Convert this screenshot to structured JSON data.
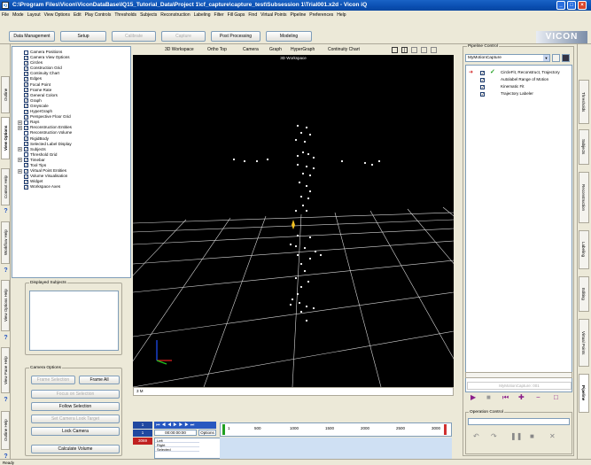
{
  "window": {
    "title": "C:\\Program Files\\Vicon\\ViconDataBase\\IQ15_Tutorial_Data\\Project 1\\cf_capture\\capture_test\\Subsession 1\\Trial001.x2d - Vicon iQ",
    "minimize": "_",
    "maximize": "□",
    "close": "×",
    "brand": "VICON"
  },
  "menu": [
    "File",
    "Mode",
    "Layout",
    "View Options",
    "Edit",
    "Play Controls",
    "Thresholds",
    "Subjects",
    "Reconstruction",
    "Labeling",
    "Filter",
    "Fill Gaps",
    "Find",
    "Virtual Points",
    "Pipeline",
    "Preferences",
    "Help"
  ],
  "toolbar": {
    "data_management": "Data Management",
    "setup": "Setup",
    "calibrate": "Calibrate",
    "capture": "Capture",
    "post_processing": "Post Processing",
    "modeling": "Modeling"
  },
  "left_tabs": [
    "Outline",
    "View Options",
    "Context Help",
    "Workflow Help",
    "View Options Help",
    "View Pane Help",
    "Outline Help"
  ],
  "view_options": {
    "items": [
      {
        "label": "Camera Positions",
        "checked": false,
        "expander": false
      },
      {
        "label": "Camera View Options",
        "checked": true,
        "expander": false
      },
      {
        "label": "Circles",
        "checked": true,
        "expander": false
      },
      {
        "label": "Construction Grid",
        "checked": true,
        "expander": false
      },
      {
        "label": "Continuity Chart",
        "checked": true,
        "expander": false
      },
      {
        "label": "Edges",
        "checked": true,
        "expander": false
      },
      {
        "label": "Focal Point",
        "checked": true,
        "expander": false
      },
      {
        "label": "Frame Rate",
        "checked": true,
        "expander": false
      },
      {
        "label": "General Colors",
        "checked": true,
        "expander": false
      },
      {
        "label": "Graph",
        "checked": true,
        "expander": false
      },
      {
        "label": "Greyscale",
        "checked": true,
        "expander": false
      },
      {
        "label": "HyperGraph",
        "checked": true,
        "expander": false
      },
      {
        "label": "Perspective Floor Grid",
        "checked": true,
        "expander": false
      },
      {
        "label": "Rays",
        "checked": false,
        "expander": true
      },
      {
        "label": "Reconstruction Entities",
        "checked": true,
        "expander": true
      },
      {
        "label": "Reconstruction Volume",
        "checked": false,
        "expander": false
      },
      {
        "label": "RigidBody",
        "checked": true,
        "expander": false
      },
      {
        "label": "Selected Label Display",
        "checked": true,
        "expander": false
      },
      {
        "label": "Subjects",
        "checked": true,
        "expander": true
      },
      {
        "label": "Threshold Grid",
        "checked": false,
        "expander": false
      },
      {
        "label": "Timebar",
        "checked": true,
        "expander": true
      },
      {
        "label": "Tool Tips",
        "checked": true,
        "expander": false
      },
      {
        "label": "Virtual Point Entities",
        "checked": true,
        "expander": true
      },
      {
        "label": "Volume Visualisation",
        "checked": true,
        "expander": false
      },
      {
        "label": "Widget",
        "checked": true,
        "expander": false
      },
      {
        "label": "Workspace Axes",
        "checked": true,
        "expander": false
      }
    ]
  },
  "displayed_subjects": {
    "label": "Displayed Subjects"
  },
  "camera_options": {
    "label": "Camera Options",
    "frame_selection": "Frame Selection",
    "frame_all": "Frame All",
    "focus_on_selection": "Focus on Selection",
    "follow_selection": "Follow Selection",
    "set_camera_look_target": "Set Camera Look Target",
    "lock_camera": "Lock Camera",
    "calculate_volume": "Calculate Volume"
  },
  "view_toolbar": {
    "workspace": "3D Workspace",
    "ortho": "Ortho Top",
    "camera": "Camera",
    "graph": "Graph",
    "hypergraph": "HyperGraph",
    "continuity": "Continuity Chart"
  },
  "viewport": {
    "header": "3D Workspace",
    "bottom_label": "3 M"
  },
  "timebar": {
    "frame_start": "1",
    "frame_current": "1",
    "frame_end": "3069",
    "timecode": "00:00:00:00",
    "options": "Options",
    "ticks": [
      "1",
      "500",
      "1000",
      "1500",
      "2000",
      "2500",
      "3000"
    ],
    "tracks": [
      "Left",
      "Right",
      "Selected"
    ]
  },
  "pipeline": {
    "label": "Pipeline Control",
    "selected": "MyMotionCapture",
    "items": [
      {
        "label": "CircleFit, Reconstruct, Trajectory",
        "checked": true,
        "active": true
      },
      {
        "label": "Autolabel Range of Motion",
        "checked": true,
        "active": false
      },
      {
        "label": "Kinematic Fit",
        "checked": true,
        "active": false
      },
      {
        "label": "Trajectory Labeler",
        "checked": true,
        "active": false
      }
    ],
    "name_field": "MyMotionCapture: 001"
  },
  "operation_control": {
    "label": "Operation Control"
  },
  "right_tabs": [
    "Thresholds",
    "Subjects",
    "Reconstruction",
    "Labeling",
    "Editing",
    "Virtual Points",
    "Pipeline"
  ],
  "status": {
    "left": "Ready"
  }
}
